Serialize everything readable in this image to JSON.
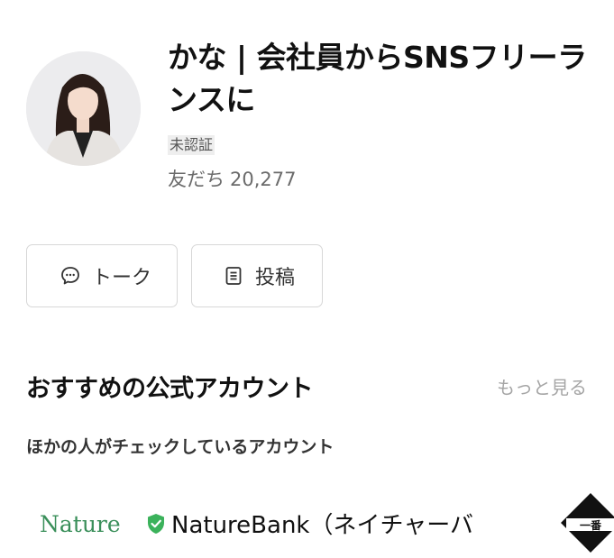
{
  "profile": {
    "name": "かな | 会社員からSNSフリーランスに",
    "badge": "未認証",
    "friends_label": "友だち",
    "friends_count": "20,277"
  },
  "actions": {
    "talk_label": "トーク",
    "post_label": "投稿"
  },
  "recommend": {
    "title": "おすすめの公式アカウント",
    "more_label": "もっと見る",
    "subtitle": "ほかの人がチェックしているアカウント",
    "accounts": [
      {
        "logo_text": "Nature",
        "name": "NatureBank（ネイチャーバン"
      }
    ],
    "right_logo_text": "一番"
  },
  "colors": {
    "verified_green": "#3bb25b",
    "muted_text": "#6b6b6b",
    "border": "#d7d7d7"
  },
  "icons": {
    "talk": "chat-bubble-icon",
    "post": "document-icon",
    "verified": "shield-check-icon"
  }
}
